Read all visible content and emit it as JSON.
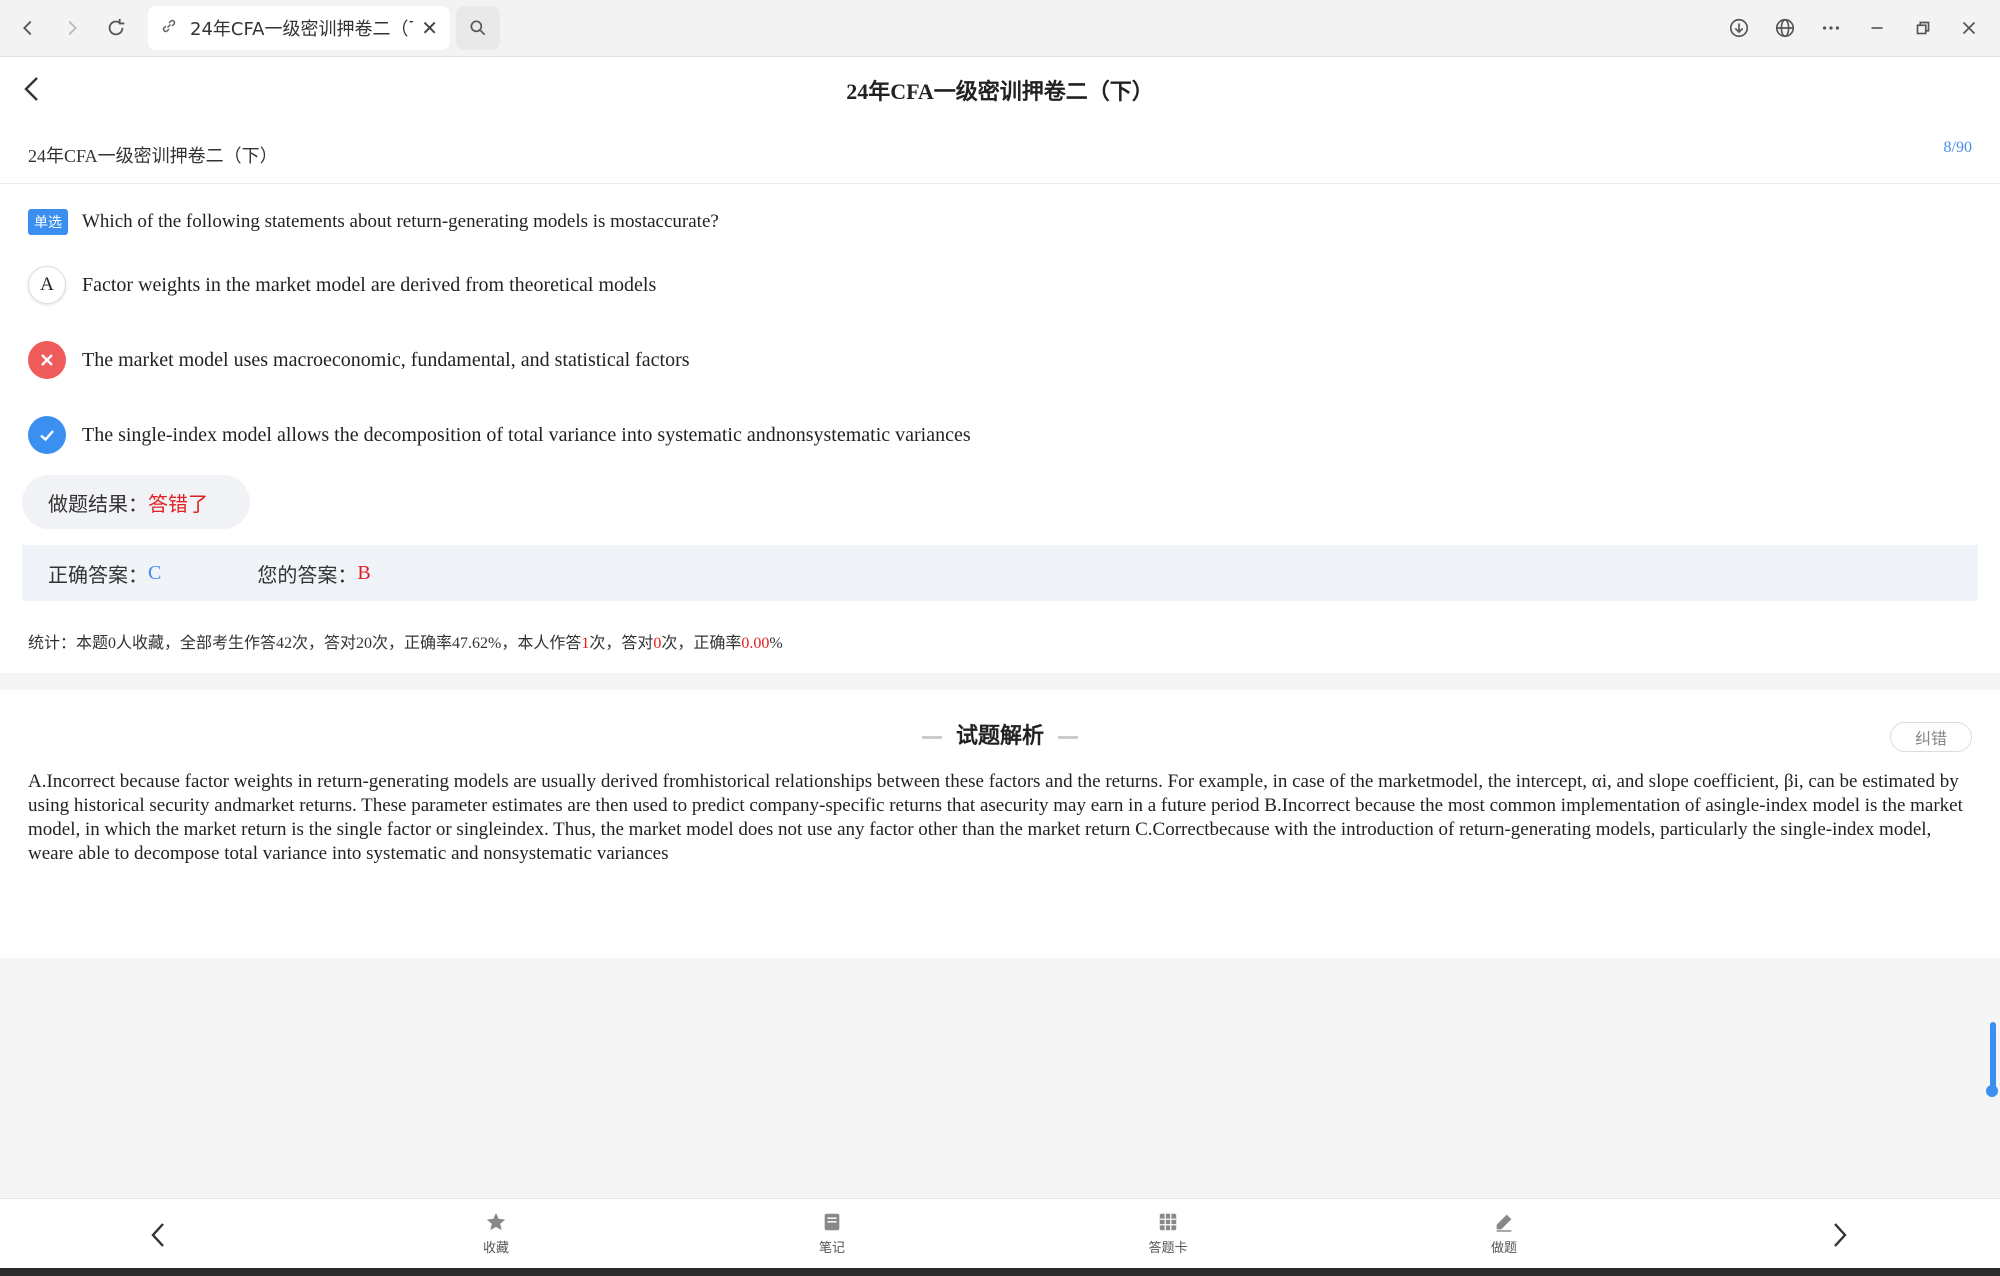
{
  "browser": {
    "tab_title": "24年CFA一级密训押卷二（下）"
  },
  "header": {
    "title": "24年CFA一级密训押卷二（下）"
  },
  "exam": {
    "subtitle": "24年CFA一级密训押卷二（下）",
    "page_count": "8/90"
  },
  "question": {
    "type_badge": "单选",
    "text": "Which of the following statements about return-generating models is mostaccurate?",
    "options": [
      {
        "mark": "A",
        "state": "neutral",
        "text": "Factor weights in the market model are derived from theoretical models"
      },
      {
        "mark": "",
        "state": "wrong",
        "text": "The market model uses macroeconomic, fundamental, and statistical factors"
      },
      {
        "mark": "",
        "state": "correct",
        "text": "The single-index model allows the decomposition of total variance into systematic andnonsystematic variances"
      }
    ]
  },
  "result": {
    "label": "做题结果：",
    "value": "答错了"
  },
  "answers": {
    "correct_label": "正确答案：",
    "correct_value": "C",
    "yours_label": "您的答案：",
    "yours_value": "B"
  },
  "stats": {
    "p1": "统计：本题0人收藏，全部考生作答42次，答对20次，正确率47.62%，本人作答",
    "v1": "1",
    "p2": "次，答对",
    "v2": "0",
    "p3": "次，正确率",
    "v3": "0.00",
    "p4": "%"
  },
  "analysis": {
    "title": "试题解析",
    "report_label": "纠错",
    "text": "A.Incorrect because factor weights in return-generating models are usually derived fromhistorical relationships between these factors and the returns. For example, in case of the marketmodel, the intercept, αi, and slope coefficient, βi, can be estimated by using historical security andmarket returns. These parameter estimates are then used to predict company-specific returns that asecurity may earn in a future period B.Incorrect because the most common implementation of asingle-index model is the market model, in which the market return is the single factor or singleindex. Thus, the market model does not use any factor other than the market return C.Correctbecause with the introduction of return-generating models, particularly the single-index model, weare able to decompose total variance into systematic and nonsystematic variances"
  },
  "bottom_bar": {
    "favorite": "收藏",
    "notes": "笔记",
    "answer_card": "答题卡",
    "practice": "做题"
  },
  "colors": {
    "accent": "#3b8ff0",
    "error": "#e02020",
    "wrong_mark": "#ef5b5b"
  }
}
